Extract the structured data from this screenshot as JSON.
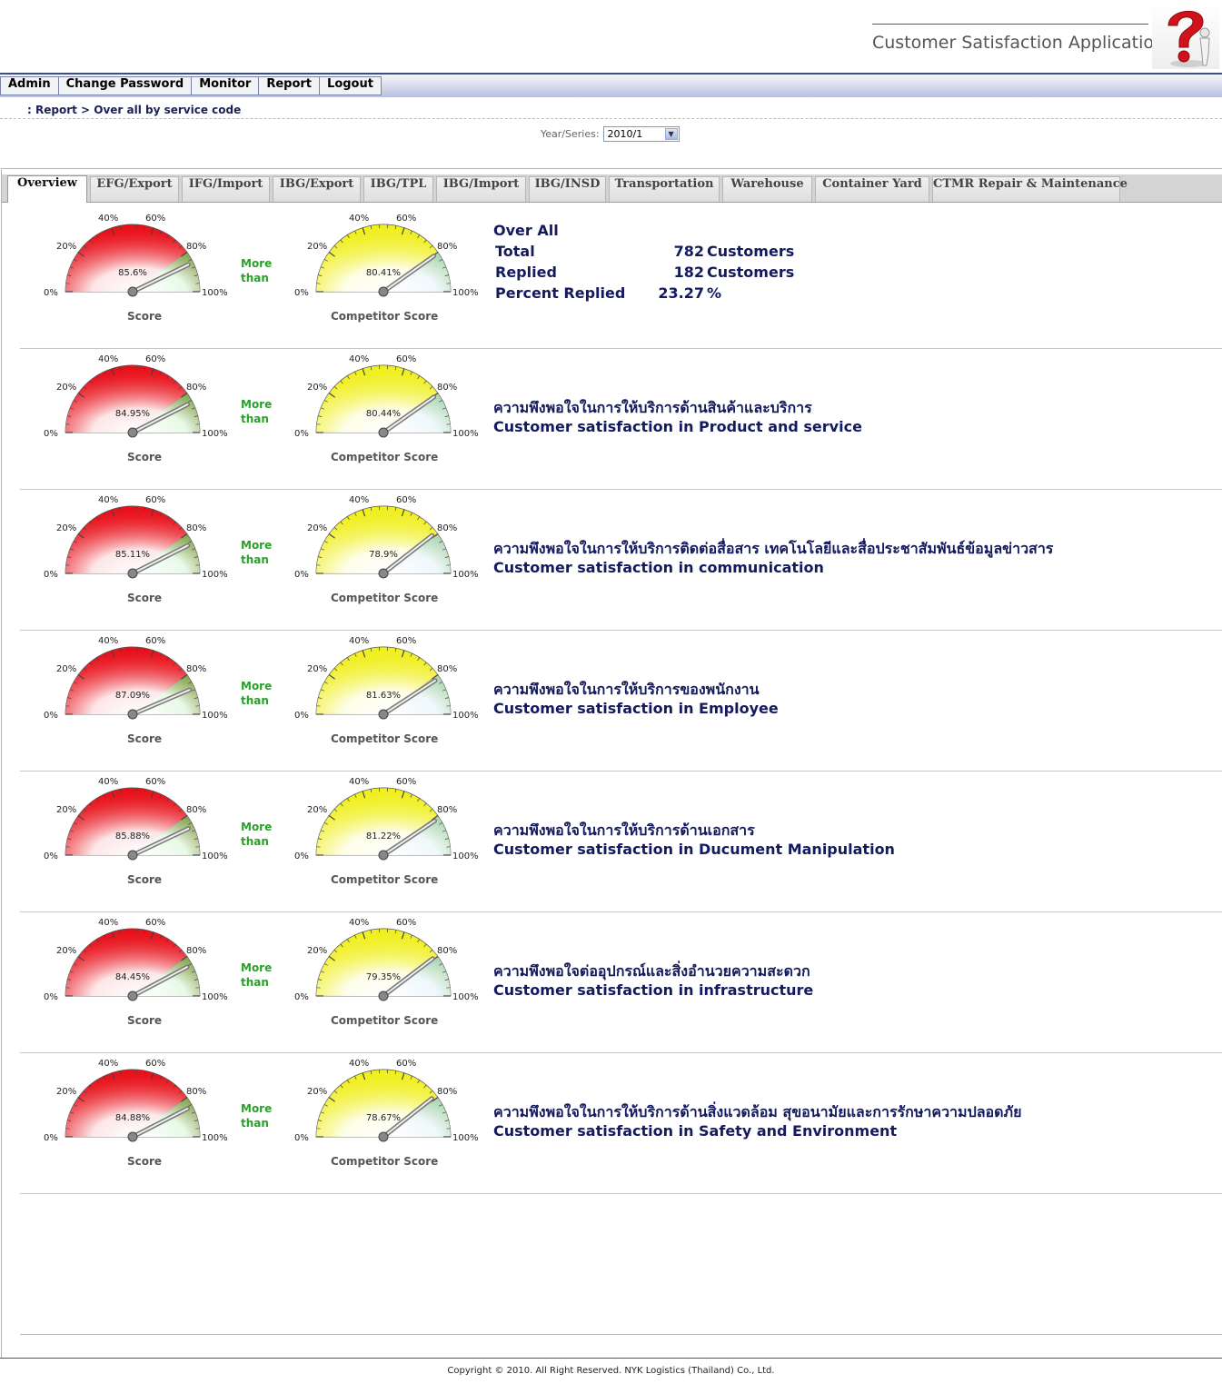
{
  "header": {
    "app_title": "Customer Satisfaction Application."
  },
  "menu": [
    {
      "label": "Admin"
    },
    {
      "label": "Change Password"
    },
    {
      "label": "Monitor"
    },
    {
      "label": "Report"
    },
    {
      "label": "Logout"
    }
  ],
  "breadcrumb": ": Report > Over all by service code",
  "filter": {
    "label": "Year/Series:",
    "value": "2010/1"
  },
  "tabs": [
    {
      "label": "Overview",
      "active": true
    },
    {
      "label": "EFG/Export"
    },
    {
      "label": "IFG/Import"
    },
    {
      "label": "IBG/Export"
    },
    {
      "label": "IBG/TPL"
    },
    {
      "label": "IBG/Import"
    },
    {
      "label": "IBG/INSD"
    },
    {
      "label": "Transportation"
    },
    {
      "label": "Warehouse"
    },
    {
      "label": "Container Yard"
    },
    {
      "label": "CTMR Repair & Maintenance"
    }
  ],
  "gauge_ticks": [
    "0%",
    "20%",
    "40%",
    "60%",
    "80%",
    "100%"
  ],
  "gauge_colors": {
    "score_main": "#e8101a",
    "score_high": "#14c814",
    "competitor_main": "#f0ef1e",
    "competitor_high": "#5fb6dc"
  },
  "comparison_label": {
    "line1": "More",
    "line2": "than"
  },
  "labels": {
    "score": "Score",
    "competitor": "Competitor Score"
  },
  "overall": {
    "title": "Over All",
    "total_label": "Total",
    "total_value": "782",
    "total_unit": "Customers",
    "replied_label": "Replied",
    "replied_value": "182",
    "replied_unit": "Customers",
    "percent_label": "Percent Replied",
    "percent_value": "23.27",
    "percent_unit": "%"
  },
  "rows": [
    {
      "score": "85.6%",
      "score_value": 85.6,
      "competitor": "80.41%",
      "competitor_value": 80.41,
      "thai": "",
      "english": ""
    },
    {
      "score": "84.95%",
      "score_value": 84.95,
      "competitor": "80.44%",
      "competitor_value": 80.44,
      "thai": "ความพึงพอใจในการให้บริการด้านสินค้าและบริการ",
      "english": "Customer satisfaction in Product and service"
    },
    {
      "score": "85.11%",
      "score_value": 85.11,
      "competitor": "78.9%",
      "competitor_value": 78.9,
      "thai": "ความพึงพอใจในการให้บริการติดต่อสื่อสาร เทคโนโลยีและสื่อประชาสัมพันธ์ข้อมูลข่าวสาร",
      "english": "Customer satisfaction in communication"
    },
    {
      "score": "87.09%",
      "score_value": 87.09,
      "competitor": "81.63%",
      "competitor_value": 81.63,
      "thai": "ความพึงพอใจในการให้บริการของพนักงาน",
      "english": "Customer satisfaction in Employee"
    },
    {
      "score": "85.88%",
      "score_value": 85.88,
      "competitor": "81.22%",
      "competitor_value": 81.22,
      "thai": "ความพึงพอใจในการให้บริการด้านเอกสาร",
      "english": "Customer satisfaction in Ducument Manipulation"
    },
    {
      "score": "84.45%",
      "score_value": 84.45,
      "competitor": "79.35%",
      "competitor_value": 79.35,
      "thai": "ความพึงพอใจต่ออุปกรณ์และสิ่งอำนวยความสะดวก",
      "english": "Customer satisfaction in infrastructure"
    },
    {
      "score": "84.88%",
      "score_value": 84.88,
      "competitor": "78.67%",
      "competitor_value": 78.67,
      "thai": "ความพึงพอใจในการให้บริการด้านสิ่งแวดล้อม สุขอนามัยและการรักษาความปลอดภัย",
      "english": "Customer satisfaction in Safety and Environment"
    }
  ],
  "footer": "Copyright © 2010. All Right Reserved. NYK Logistics (Thailand) Co., Ltd."
}
